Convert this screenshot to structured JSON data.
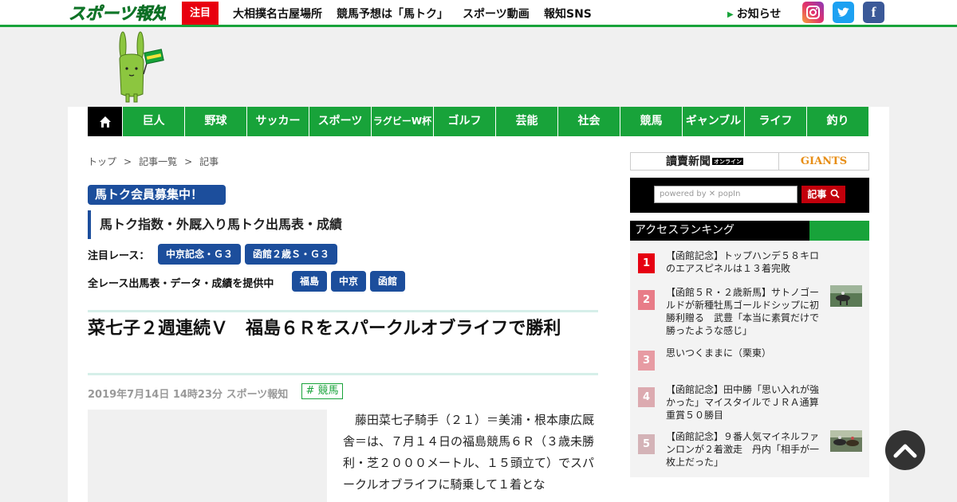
{
  "header": {
    "logo_text": "スポーツ報知",
    "attention_tag": "注目",
    "links": [
      "大相撲名古屋場所",
      "競馬予想は「馬トク」",
      "スポーツ動画",
      "報知SNS"
    ],
    "notice": "お知らせ",
    "sns": {
      "instagram_icon": "instagram-icon",
      "twitter_icon": "twitter-icon",
      "facebook_glyph": "f"
    }
  },
  "nav": {
    "home_icon": "home-icon",
    "items": [
      "巨人",
      "野球",
      "サッカー",
      "スポーツ",
      "ラグビーW杯",
      "ゴルフ",
      "芸能",
      "社会",
      "競馬",
      "ギャンブル",
      "ライフ",
      "釣り"
    ]
  },
  "breadcrumb": [
    "トップ",
    ">",
    "記事一覧",
    ">",
    "記事"
  ],
  "promo": {
    "member_badge": "馬トク会員募集中！",
    "index_title": "馬トク指数・外厩入り馬トク出馬表・成績",
    "featured_label": "注目レース：",
    "featured_races": [
      "中京記念・Ｇ３",
      "函館２歳Ｓ・Ｇ３"
    ],
    "all_races_label": "全レース出馬表・データ・成績を提供中",
    "venues": [
      "福島",
      "中京",
      "函館"
    ]
  },
  "article": {
    "headline": "菜七子２週連続Ｖ　福島６Ｒをスパークルオブライフで勝利",
    "date": "2019年7月14日 14時23分",
    "source": "スポーツ報知",
    "tag": "# 競馬",
    "body": "　藤田菜七子騎手（２１）＝美浦・根本康広厩舎＝は、７月１４日の福島競馬６Ｒ（３歳未勝利・芝２０００メートル、１５頭立て）でスパークルオブライフに騎乗して１着とな"
  },
  "sidebar": {
    "yomiuri": "讀賣新聞",
    "yomiuri_online": "オンライン",
    "giants": "GIANTS",
    "search_placeholder": "powered by ✕ popIn",
    "search_button": "記事",
    "ranking_title": "アクセスランキング",
    "ranking": [
      {
        "rank": "1",
        "text": "【函館記念】トップハンデ５８キロのエアスピネルは１３着完敗",
        "color": "#e60012",
        "thumb": false
      },
      {
        "rank": "2",
        "text": "【函館５Ｒ・２歳新馬】サトノゴールドが新種牡馬ゴールドシップに初勝利贈る　武豊「本当に素質だけで勝ったような感じ」",
        "color": "#e87c88",
        "thumb": true
      },
      {
        "rank": "3",
        "text": "思いつくままに（栗東）",
        "color": "#e79ba3",
        "thumb": false
      },
      {
        "rank": "4",
        "text": "【函館記念】田中勝「思い入れが強かった」マイスタイルでＪＲＡ通算重賞５０勝目",
        "color": "#dcaab0",
        "thumb": false
      },
      {
        "rank": "5",
        "text": "【函館記念】９番人気マイネルファンロンが２着激走　丹内「相手が一枚上だった」",
        "color": "#d4b3b7",
        "thumb": true
      }
    ]
  },
  "colors": {
    "brand_green": "#18a33a",
    "uma_blue": "#1c4e9c",
    "attention_red": "#e8000f"
  }
}
